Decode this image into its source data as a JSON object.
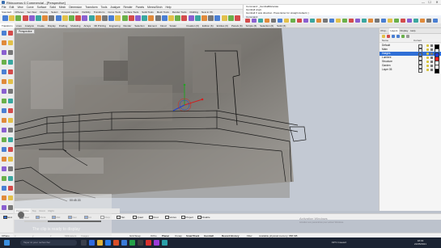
{
  "window": {
    "title": "Rhinoceros 6 Commercial - [Perspective]",
    "minimize": "—",
    "maximize": "☐",
    "close": "✕"
  },
  "menubar": [
    "File",
    "Edit",
    "View",
    "Curve",
    "Surface",
    "Solid",
    "Mesh",
    "Dimension",
    "Transform",
    "Tools",
    "Analyze",
    "Render",
    "Panels",
    "MennoStroh",
    "Help"
  ],
  "command_history": [
    "Command: _GumballRelocate",
    "Gumball origin",
    "Gumball X axis direction. Press Enter for straight default ( )"
  ],
  "command_prompt": "Command:",
  "toolbar_tabs_top": [
    "Standard",
    "CPlanes",
    "Set View",
    "Display",
    "Select",
    "Viewport Layout",
    "Visibility",
    "Transform",
    "Curve Tools",
    "Surface Tools",
    "Solid Tools",
    "Mesh Tools",
    "Render Tools",
    "Drafting",
    "New in V6"
  ],
  "toolbar_tabs_top_active": 0,
  "toolbar_tabs_main": [
    "Transform",
    "Lines",
    "Analysis",
    "Create",
    "Display",
    "Drafting",
    "Modeling",
    "Arrays",
    "3D Printing",
    "Engraving",
    "Render",
    "Selection",
    "Element",
    "Cloud",
    "Scaler"
  ],
  "toolbar_tabs_main_active": 0,
  "toolbar_tabs_right": [
    "Creation (6)",
    "Edition (6)",
    "Entities (6)",
    "Panels (6)",
    "Scripts (6)",
    "Selection (6)",
    "Solid (6)"
  ],
  "viewport": {
    "label": "Perspective"
  },
  "right_panel": {
    "tabs": [
      "Prop...",
      "Layers",
      "Display",
      "Help"
    ],
    "active_tab": 1,
    "header_name": "Name",
    "header_current": "Current",
    "layers": [
      {
        "name": "Default",
        "color": "#000000",
        "selected": false
      },
      {
        "name": "Main",
        "color": "#ffffff",
        "selected": false
      },
      {
        "name": "Images",
        "color": "#1c3bd8",
        "selected": true
      },
      {
        "name": "Lumiere",
        "color": "#ff2020",
        "selected": false
      },
      {
        "name": "Structure",
        "color": "#ffffff",
        "selected": false
      },
      {
        "name": "Garden",
        "color": "#ffffff",
        "selected": false
      },
      {
        "name": "Layer 05",
        "color": "#000000",
        "selected": false
      }
    ]
  },
  "view_tabs": [
    "Perspective",
    "Top",
    "Front",
    "Right"
  ],
  "view_tabs_active": 0,
  "osnaps": [
    {
      "label": "End",
      "on": true
    },
    {
      "label": "Near",
      "on": true
    },
    {
      "label": "Point",
      "on": true
    },
    {
      "label": "Mid",
      "on": true
    },
    {
      "label": "Cen",
      "on": true
    },
    {
      "label": "Int",
      "on": true
    },
    {
      "label": "Perp",
      "on": false
    },
    {
      "label": "Tan",
      "on": false
    },
    {
      "label": "Quad",
      "on": false
    },
    {
      "label": "Knot",
      "on": false
    },
    {
      "label": "Vertex",
      "on": false
    },
    {
      "label": "Project",
      "on": false
    },
    {
      "label": "Disable",
      "on": false
    }
  ],
  "status_bar": {
    "cplane": "CPlane",
    "x": "x",
    "y": "y",
    "z": "z",
    "units": "Millimeters",
    "layer": "Images",
    "items": [
      {
        "label": "Grid Snap",
        "bold": false
      },
      {
        "label": "Ortho",
        "bold": false
      },
      {
        "label": "Planar",
        "bold": true
      },
      {
        "label": "Osnap",
        "bold": false
      },
      {
        "label": "SmartTrack",
        "bold": true
      },
      {
        "label": "Gumball",
        "bold": true
      },
      {
        "label": "Record History",
        "bold": true
      },
      {
        "label": "Filter",
        "bold": false
      },
      {
        "label": "Available physical memory: 888 MB",
        "bold": false
      }
    ]
  },
  "clip_overlay": {
    "time": "00:45.33",
    "message": "The clip is ready to display"
  },
  "watermark": {
    "title": "Activation Windows",
    "subtitle": "Accédez aux paramètres pour activer Windows."
  },
  "taskbar": {
    "search_placeholder": "Taper ici pour rechercher",
    "tray_status": "19°C Couvert",
    "time": "18:03",
    "date": "21/05/2021"
  }
}
